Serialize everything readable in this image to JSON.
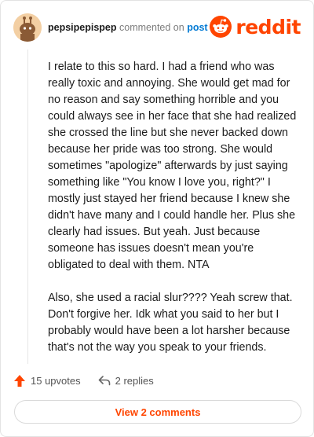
{
  "header": {
    "username": "pepsipepispep",
    "commented_text": "commented on",
    "post_link": "post",
    "logo_text": "reddit",
    "brand_color": "#ff4500"
  },
  "comment": {
    "paragraphs": [
      "I relate to this so hard. I had a friend who was really toxic and annoying. She would get mad for no reason and say something horrible and you could always see in her face that she had realized she crossed the line but she never backed down because her pride was too strong. She would sometimes \"apologize\" afterwards by just saying something like \"You know I love you, right?\" I mostly just stayed her friend because I knew she didn't have many and I could handle her. Plus she clearly had issues. But yeah. Just because someone has issues doesn't mean you're obligated to deal with them. NTA",
      "Also, she used a racial slur???? Yeah screw that. Don't forgive her. Idk what you said to her but I probably would have been a lot harsher because that's not the way you speak to your friends."
    ]
  },
  "actions": {
    "upvotes": "15 upvotes",
    "replies": "2 replies",
    "upvote_icon": "upvote-arrow-icon",
    "reply_icon": "reply-arrow-icon"
  },
  "footer": {
    "view_comments": "View 2 comments"
  }
}
